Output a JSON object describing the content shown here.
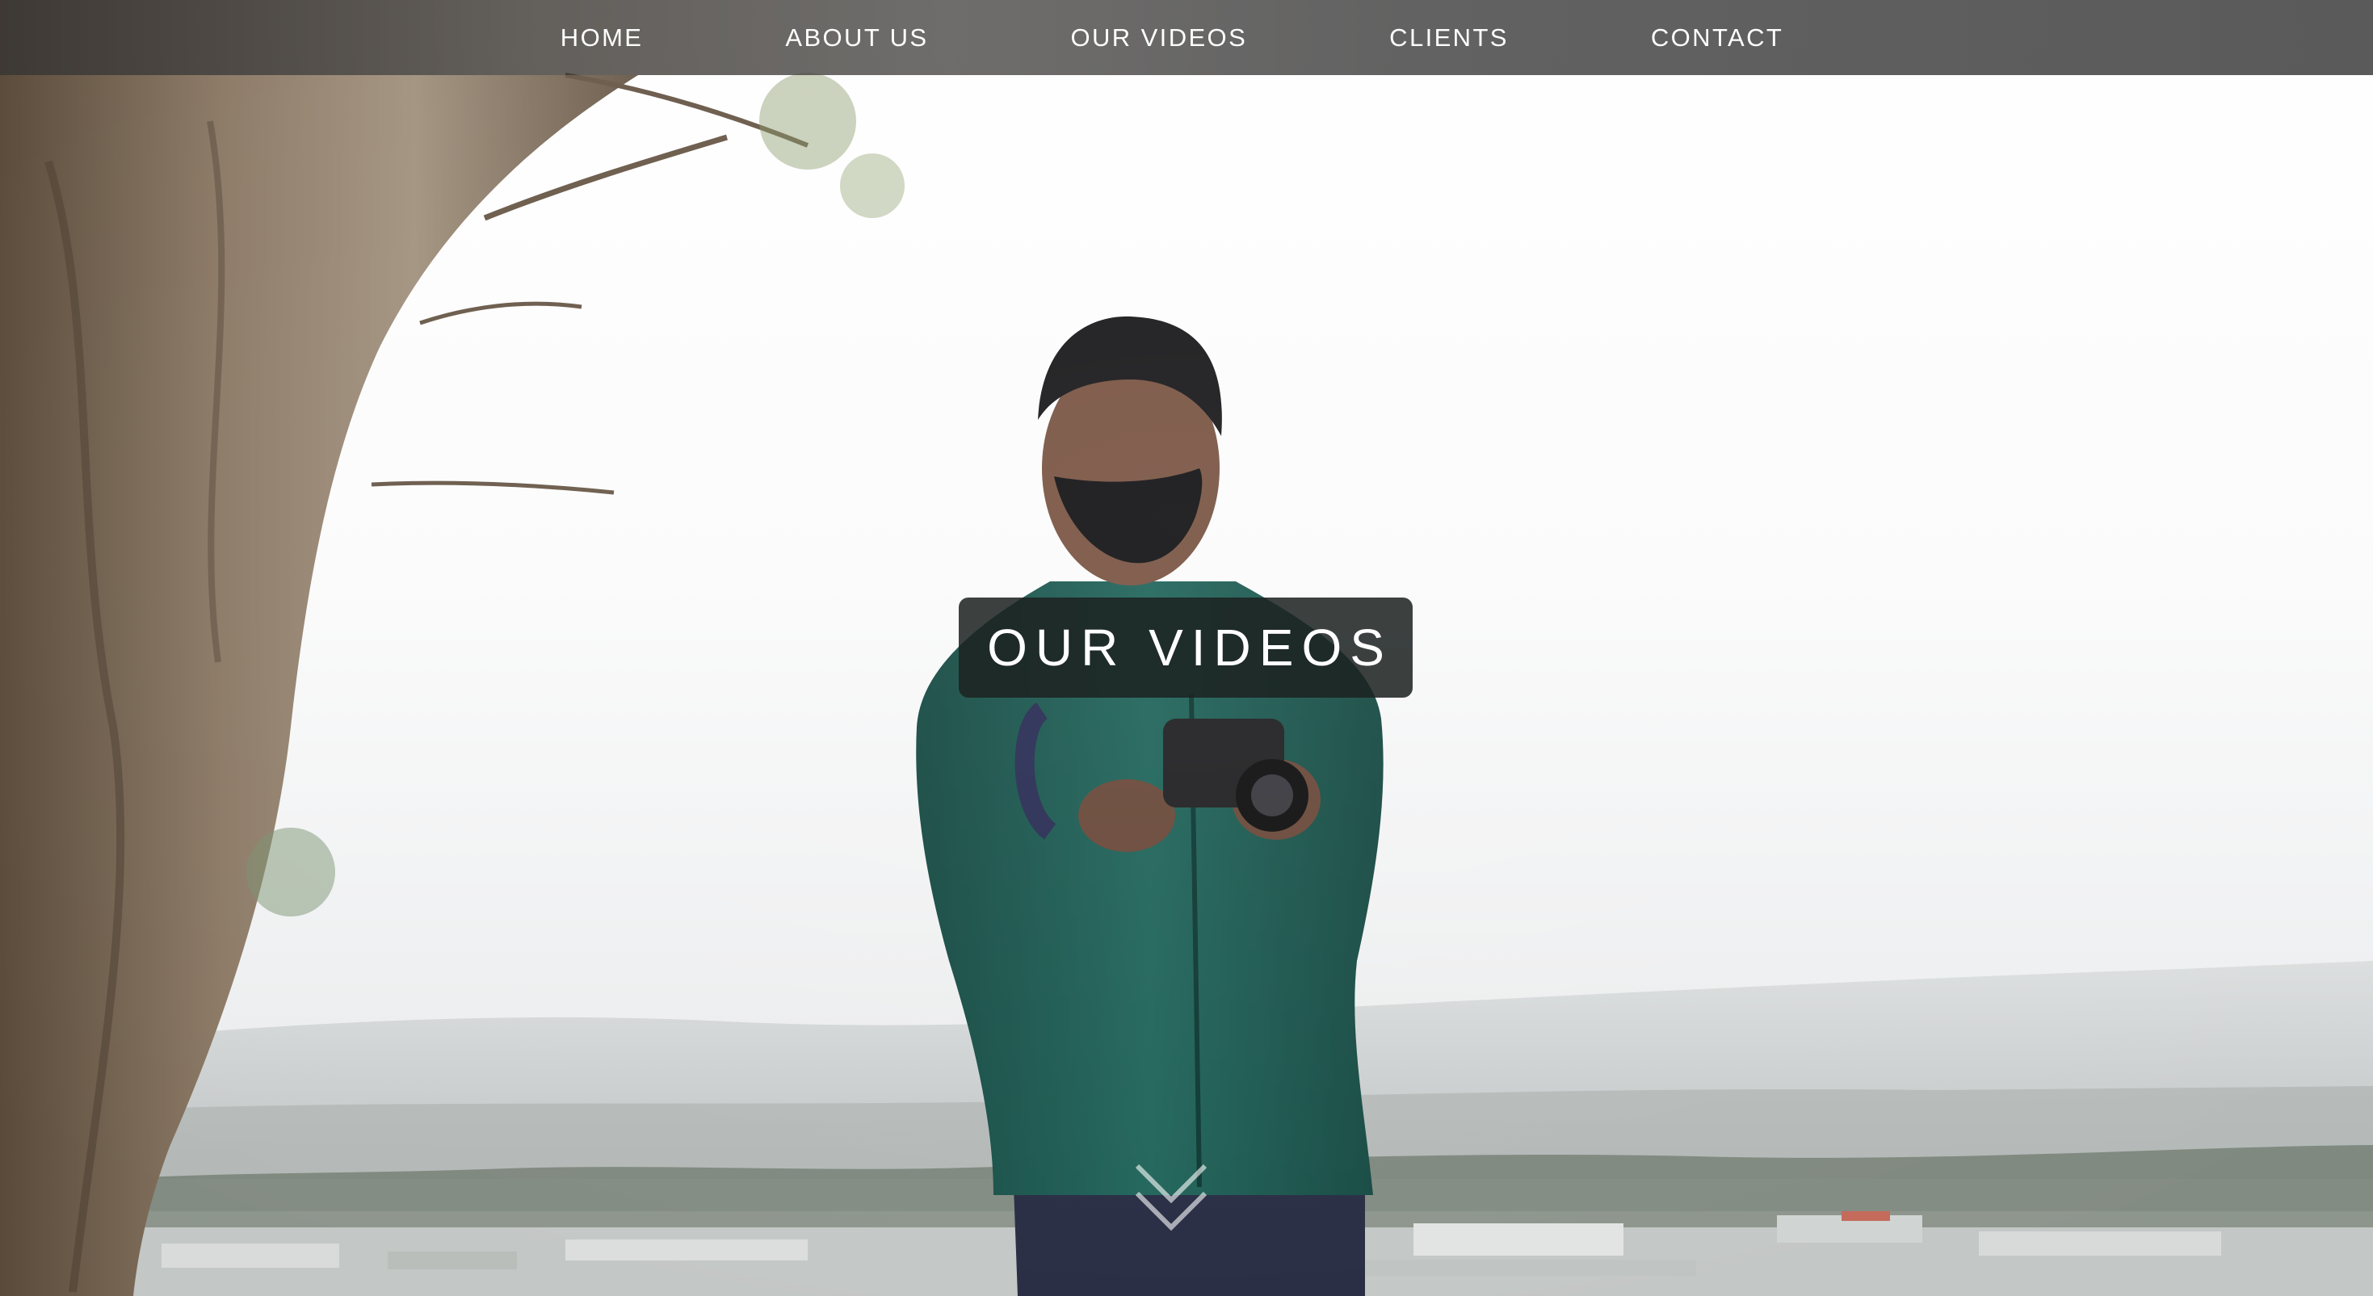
{
  "nav": {
    "items": [
      {
        "label": "HOME"
      },
      {
        "label": "ABOUT US"
      },
      {
        "label": "OUR VIDEOS"
      },
      {
        "label": "CLIENTS"
      },
      {
        "label": "CONTACT"
      }
    ]
  },
  "hero": {
    "title": "OUR VIDEOS",
    "scroll_icon": "double-chevron-down-icon"
  },
  "colors": {
    "nav_bg": "#484848",
    "headline_bg": "#1c2221",
    "text": "#ffffff",
    "hoodie": "#1f5e55"
  }
}
